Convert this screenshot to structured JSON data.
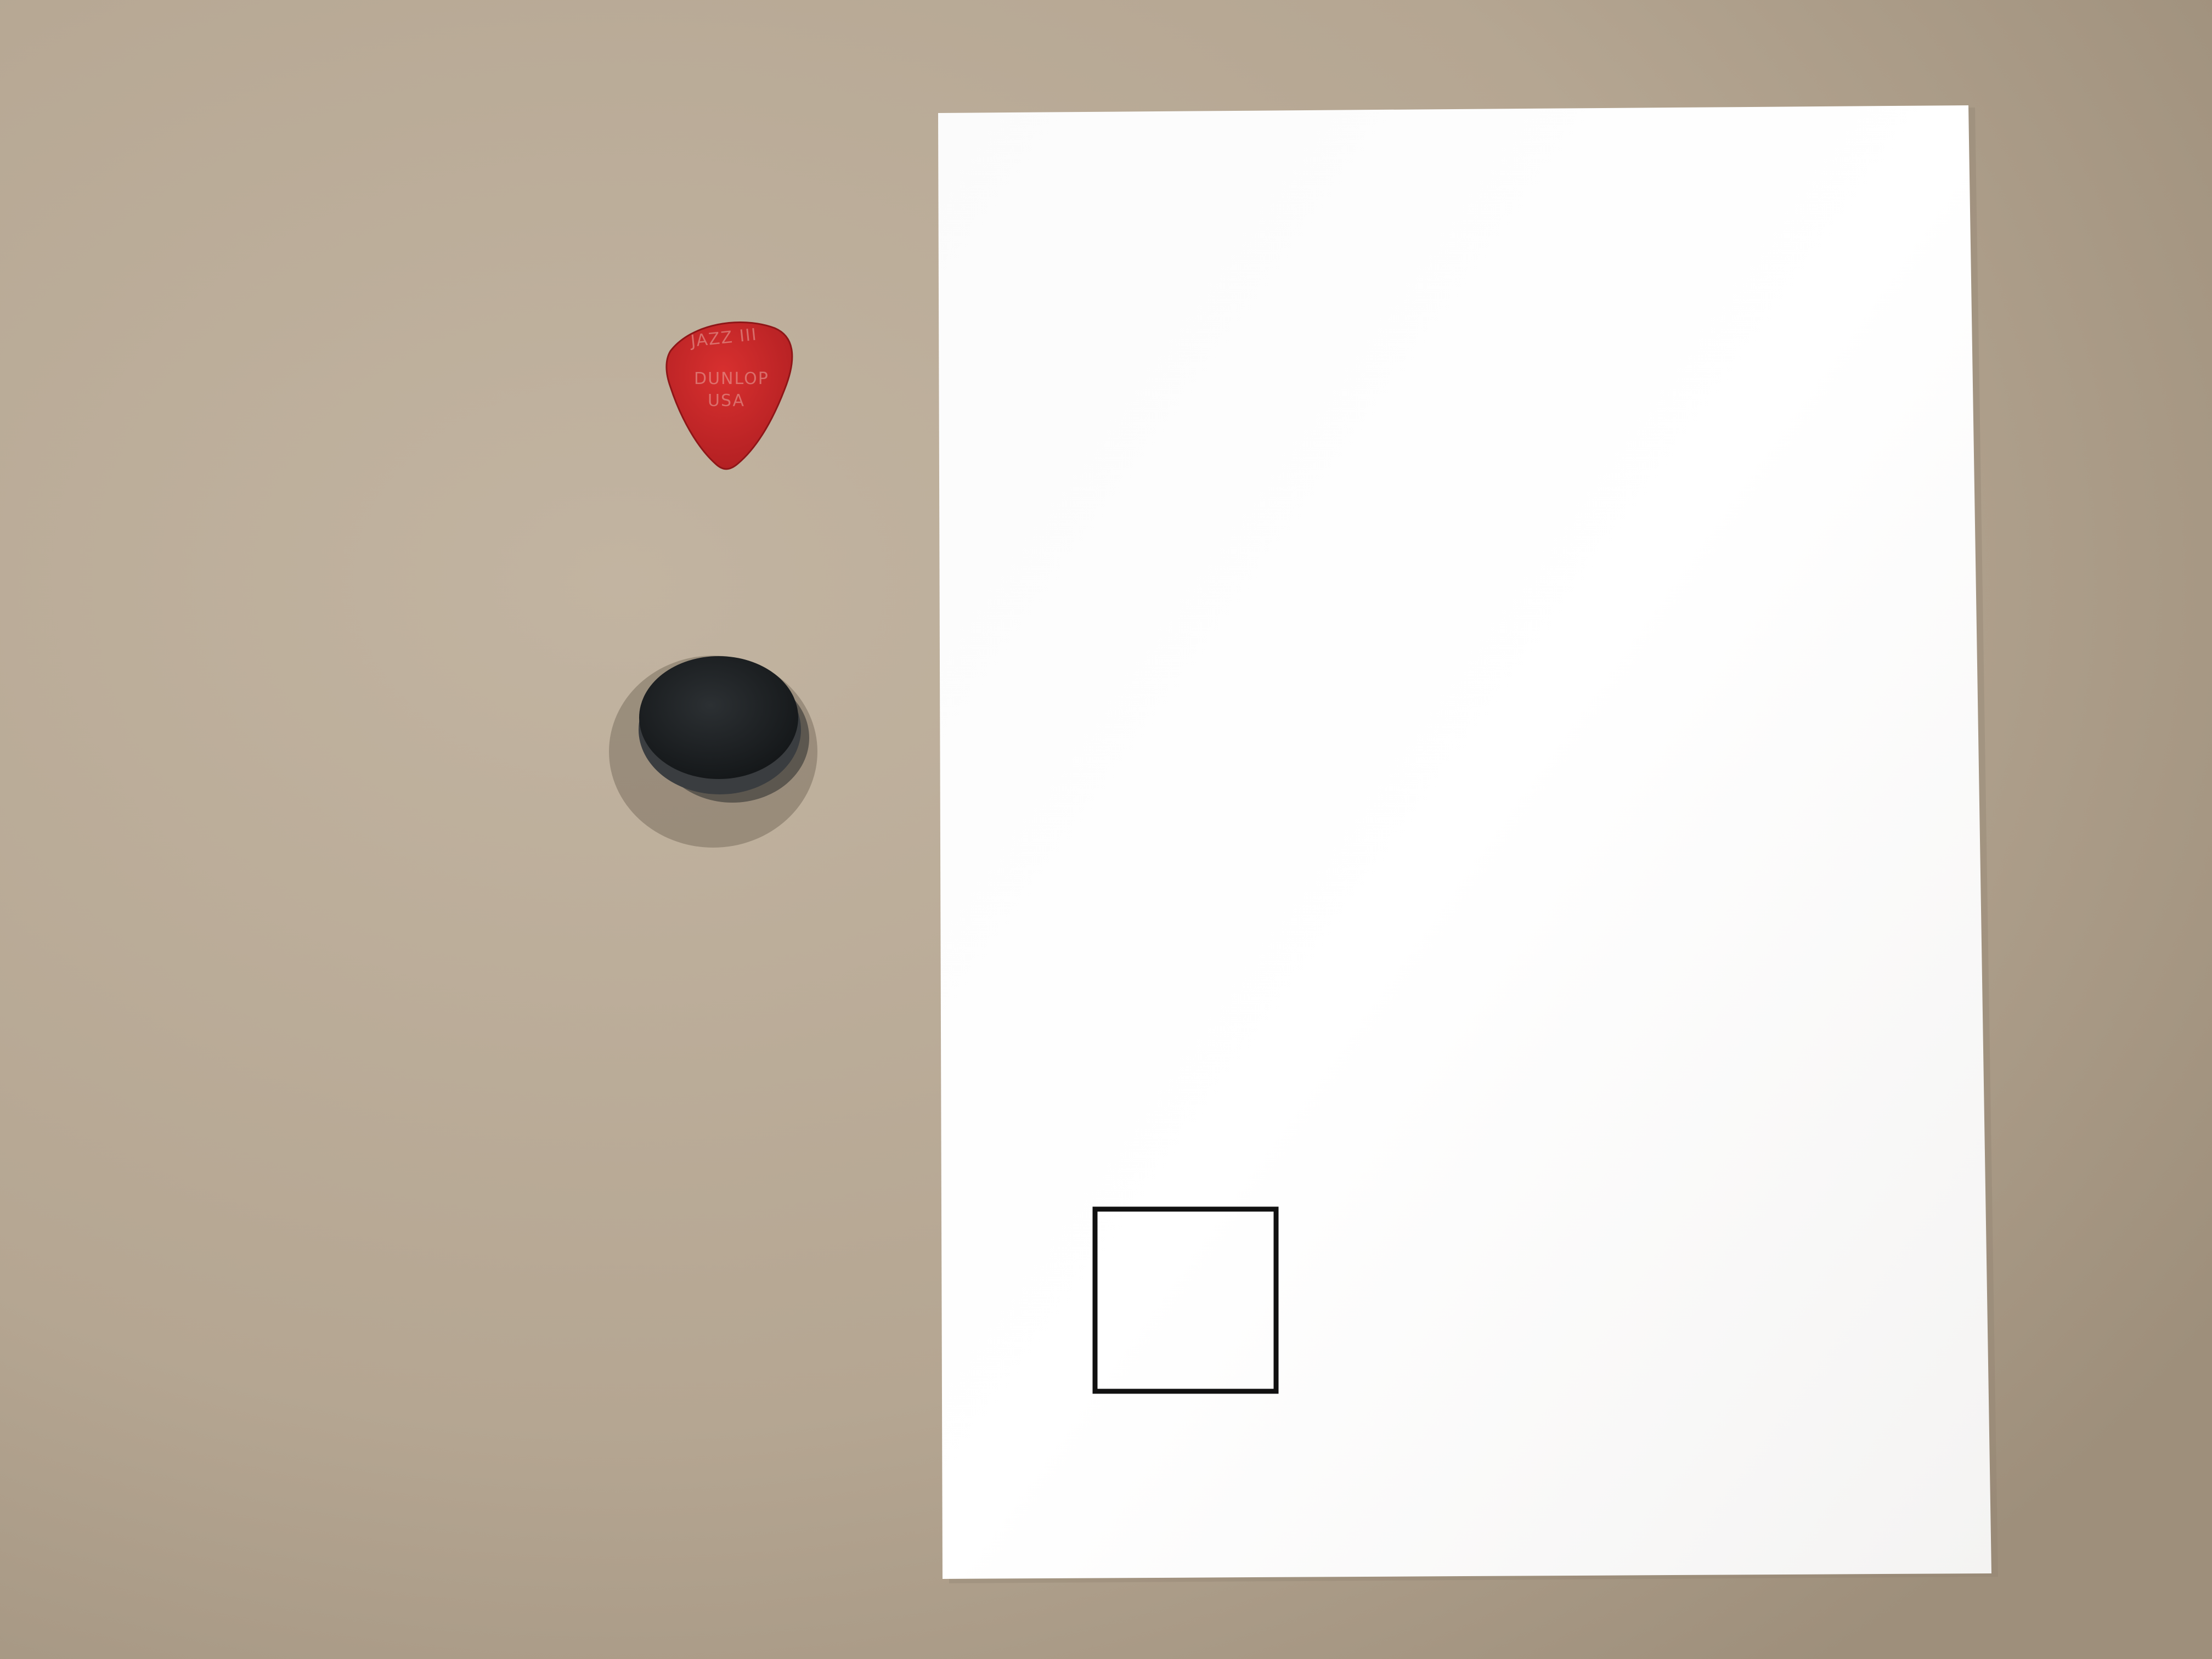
{
  "scene": {
    "description_label": "",
    "colors": {
      "tabletop": "#b6a793",
      "paper": "#ffffff",
      "square_outline": "#111111",
      "guitar_pick": "#c7272a",
      "jar_lid": "#1f2224"
    },
    "guitar_pick": {
      "lettering": [
        "JAZZ III",
        "DUNLOP",
        "USA"
      ]
    }
  }
}
